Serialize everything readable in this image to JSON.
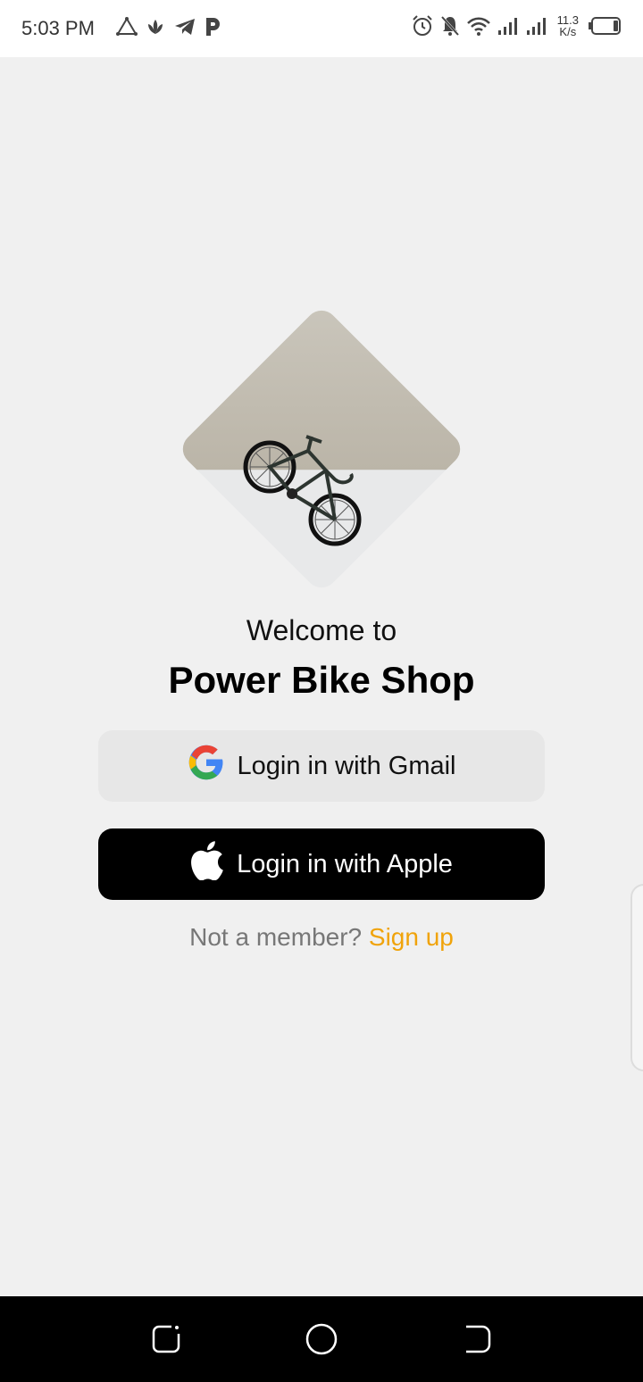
{
  "status_bar": {
    "time": "5:03 PM",
    "net_speed_value": "11.3",
    "net_speed_unit": "K/s",
    "left_icons": [
      "triangle-app-icon",
      "lotus-app-icon",
      "telegram-icon",
      "p-app-icon"
    ],
    "right_icons": [
      "alarm-icon",
      "mute-icon",
      "wifi-icon",
      "signal-icon",
      "signal-icon",
      "battery-icon"
    ]
  },
  "welcome": {
    "line1": "Welcome to",
    "title": "Power Bike Shop"
  },
  "buttons": {
    "gmail_label": "Login in with Gmail",
    "apple_label": "Login in with Apple"
  },
  "signup": {
    "prompt": "Not a member?",
    "link": "Sign up"
  },
  "colors": {
    "background": "#f0f0f0",
    "apple_button": "#000000",
    "gmail_button": "#e7e7e7",
    "accent": "#f0a30a"
  },
  "nav_bar": {
    "icons": [
      "recent-apps-icon",
      "home-icon",
      "back-icon"
    ]
  }
}
